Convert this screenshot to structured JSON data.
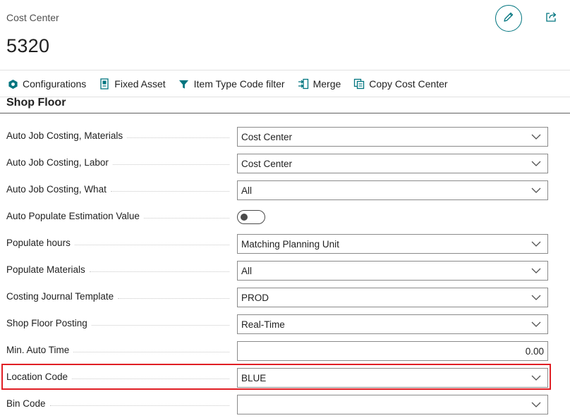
{
  "header": {
    "caption": "Cost Center",
    "number": "5320"
  },
  "actions": [
    {
      "label": "Configurations",
      "icon": "hexagon-icon"
    },
    {
      "label": "Fixed Asset",
      "icon": "document-icon"
    },
    {
      "label": "Item Type Code filter",
      "icon": "filter-icon"
    },
    {
      "label": "Merge",
      "icon": "merge-icon"
    },
    {
      "label": "Copy Cost Center",
      "icon": "copy-icon"
    }
  ],
  "section": {
    "title": "Shop Floor"
  },
  "fields": {
    "auto_job_costing_materials": {
      "label": "Auto Job Costing, Materials",
      "value": "Cost Center"
    },
    "auto_job_costing_labor": {
      "label": "Auto Job Costing, Labor",
      "value": "Cost Center"
    },
    "auto_job_costing_what": {
      "label": "Auto Job Costing, What",
      "value": "All"
    },
    "auto_populate_estimation_value": {
      "label": "Auto Populate Estimation Value",
      "value": "off"
    },
    "populate_hours": {
      "label": "Populate hours",
      "value": "Matching Planning Unit"
    },
    "populate_materials": {
      "label": "Populate Materials",
      "value": "All"
    },
    "costing_journal_template": {
      "label": "Costing Journal Template",
      "value": "PROD"
    },
    "shop_floor_posting": {
      "label": "Shop Floor Posting",
      "value": "Real-Time"
    },
    "min_auto_time": {
      "label": "Min. Auto Time",
      "value": "0.00"
    },
    "location_code": {
      "label": "Location Code",
      "value": "BLUE"
    },
    "bin_code": {
      "label": "Bin Code",
      "value": ""
    }
  },
  "colors": {
    "accent": "#00757f",
    "highlight": "#e01e24"
  }
}
